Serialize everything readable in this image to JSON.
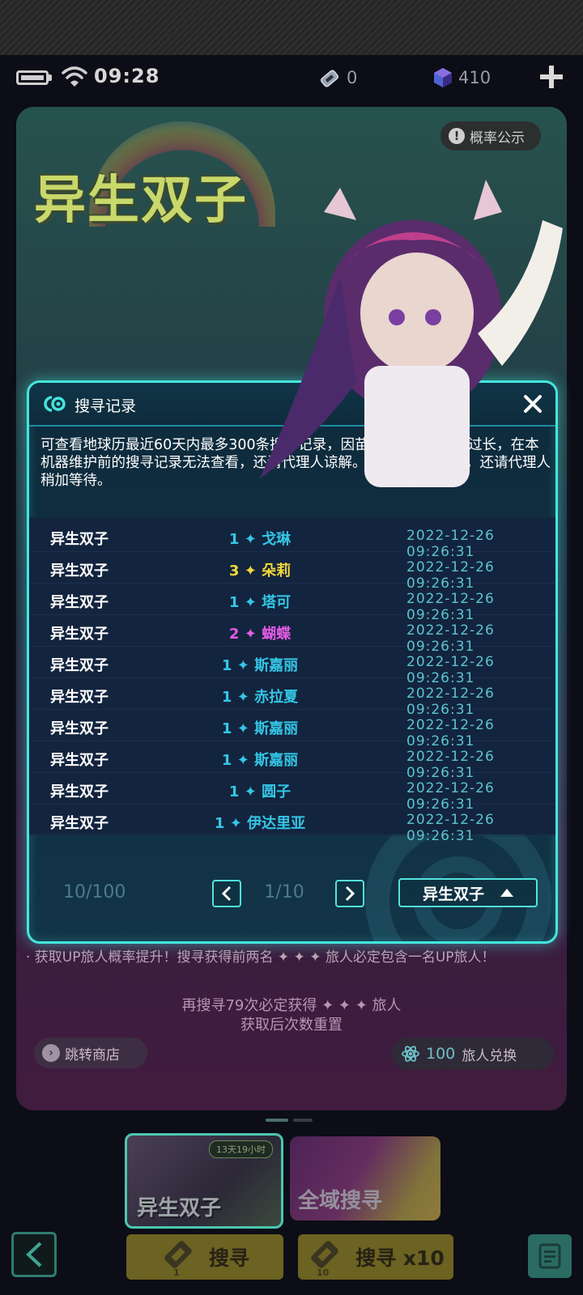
{
  "status": {
    "time": "09:28",
    "tickets": "0",
    "cubes": "410"
  },
  "event": {
    "title": "异生双子",
    "prob_label": "概率公示",
    "line1": "· 获取UP旅人概率提升！搜寻获得前两名 ✦ ✦ ✦ 旅人必定包含一名UP旅人！",
    "guarantee_line": "再搜寻79次必定获得 ✦ ✦ ✦ 旅人",
    "reset_line": "获取后次数重置",
    "shop_label": "跳转商店",
    "exchange_count": "100",
    "exchange_label": "旅人兑换",
    "banners": [
      {
        "label": "异生双子",
        "timer": "13天19小时"
      },
      {
        "label": "全域搜寻"
      }
    ],
    "search_one": {
      "label": "搜寻",
      "ticket_count": "1"
    },
    "search_ten": {
      "label": "搜寻 x10",
      "ticket_count": "10"
    }
  },
  "modal": {
    "title": "搜寻记录",
    "description": "可查看地球历最近60天内最多300条搜寻记录，因苗基地讯号传输流过长，在本机器维护前的搜寻记录无法查看，还请代理人谅解。若数据存在延迟，还请代理人稍加等待。",
    "records": [
      {
        "pool": "异生双子",
        "rarity": "1",
        "name": "戈琳",
        "time": "2022-12-26 09:26:31",
        "color": "#34c6e6"
      },
      {
        "pool": "异生双子",
        "rarity": "3",
        "name": "朵莉",
        "time": "2022-12-26 09:26:31",
        "color": "#f3d83a"
      },
      {
        "pool": "异生双子",
        "rarity": "1",
        "name": "塔可",
        "time": "2022-12-26 09:26:31",
        "color": "#34c6e6"
      },
      {
        "pool": "异生双子",
        "rarity": "2",
        "name": "蝴蝶",
        "time": "2022-12-26 09:26:31",
        "color": "#e45be6"
      },
      {
        "pool": "异生双子",
        "rarity": "1",
        "name": "斯嘉丽",
        "time": "2022-12-26 09:26:31",
        "color": "#34c6e6"
      },
      {
        "pool": "异生双子",
        "rarity": "1",
        "name": "赤拉夏",
        "time": "2022-12-26 09:26:31",
        "color": "#34c6e6"
      },
      {
        "pool": "异生双子",
        "rarity": "1",
        "name": "斯嘉丽",
        "time": "2022-12-26 09:26:31",
        "color": "#34c6e6"
      },
      {
        "pool": "异生双子",
        "rarity": "1",
        "name": "斯嘉丽",
        "time": "2022-12-26 09:26:31",
        "color": "#34c6e6"
      },
      {
        "pool": "异生双子",
        "rarity": "1",
        "name": "圆子",
        "time": "2022-12-26 09:26:31",
        "color": "#34c6e6"
      },
      {
        "pool": "异生双子",
        "rarity": "1",
        "name": "伊达里亚",
        "time": "2022-12-26 09:26:31",
        "color": "#34c6e6"
      }
    ],
    "footer": {
      "count": "10/100",
      "page": "1/10",
      "pool_select": "异生双子"
    }
  },
  "colors": {
    "accent": "#44e6dd",
    "rarity_1": "#34c6e6",
    "rarity_2": "#e45be6",
    "rarity_3": "#f3d83a"
  }
}
